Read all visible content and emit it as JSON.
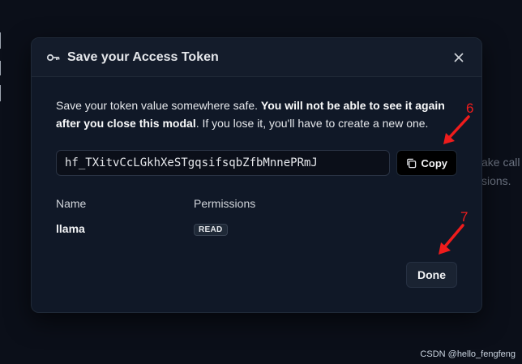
{
  "modal": {
    "title": "Save your Access Token",
    "notice_plain_1": "Save your token value somewhere safe. ",
    "notice_bold": "You will not be able to see it again after you close this modal",
    "notice_plain_2": ". If you lose it, you'll have to create a new one.",
    "token_value": "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",
    "copy_label": "Copy",
    "table": {
      "headers": [
        "Name",
        "Permissions"
      ],
      "rows": [
        {
          "name": "llama",
          "permission": "READ"
        }
      ]
    },
    "done_label": "Done"
  },
  "background": {
    "fragment_1": "ake call",
    "fragment_2": "sions."
  },
  "annotations": {
    "copy_marker": "6",
    "done_marker": "7"
  },
  "watermark": "CSDN @hello_fengfeng",
  "colors": {
    "modal_bg": "#101827",
    "header_bg": "#141c2b",
    "annotation_red": "#ef1c1c",
    "copy_button_bg": "#000000"
  }
}
